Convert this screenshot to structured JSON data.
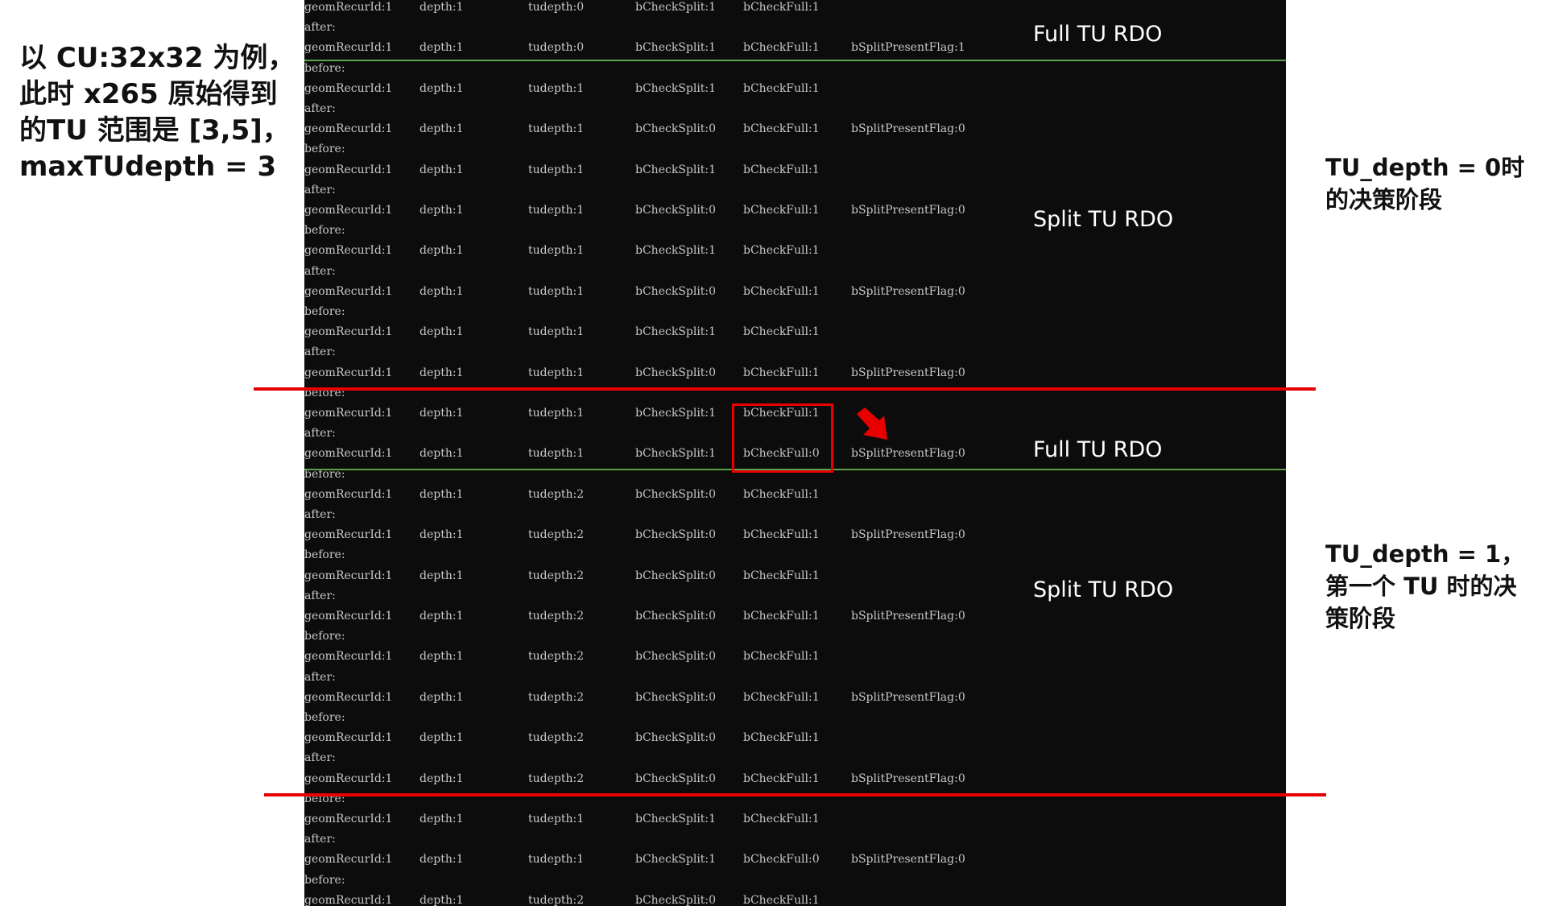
{
  "console": {
    "lines": [
      {
        "label": "geomRecurId:1",
        "depth": "depth:1",
        "tudepth": "tudepth:0",
        "split": "bCheckSplit:1",
        "full": "bCheckFull:1",
        "flag": ""
      },
      {
        "label": "after:",
        "depth": "",
        "tudepth": "",
        "split": "",
        "full": "",
        "flag": ""
      },
      {
        "label": "geomRecurId:1",
        "depth": "depth:1",
        "tudepth": "tudepth:0",
        "split": "bCheckSplit:1",
        "full": "bCheckFull:1",
        "flag": "bSplitPresentFlag:1"
      },
      {
        "label": "before:",
        "depth": "",
        "tudepth": "",
        "split": "",
        "full": "",
        "flag": ""
      },
      {
        "label": "geomRecurId:1",
        "depth": "depth:1",
        "tudepth": "tudepth:1",
        "split": "bCheckSplit:1",
        "full": "bCheckFull:1",
        "flag": ""
      },
      {
        "label": "after:",
        "depth": "",
        "tudepth": "",
        "split": "",
        "full": "",
        "flag": ""
      },
      {
        "label": "geomRecurId:1",
        "depth": "depth:1",
        "tudepth": "tudepth:1",
        "split": "bCheckSplit:0",
        "full": "bCheckFull:1",
        "flag": "bSplitPresentFlag:0"
      },
      {
        "label": "before:",
        "depth": "",
        "tudepth": "",
        "split": "",
        "full": "",
        "flag": ""
      },
      {
        "label": "geomRecurId:1",
        "depth": "depth:1",
        "tudepth": "tudepth:1",
        "split": "bCheckSplit:1",
        "full": "bCheckFull:1",
        "flag": ""
      },
      {
        "label": "after:",
        "depth": "",
        "tudepth": "",
        "split": "",
        "full": "",
        "flag": ""
      },
      {
        "label": "geomRecurId:1",
        "depth": "depth:1",
        "tudepth": "tudepth:1",
        "split": "bCheckSplit:0",
        "full": "bCheckFull:1",
        "flag": "bSplitPresentFlag:0"
      },
      {
        "label": "before:",
        "depth": "",
        "tudepth": "",
        "split": "",
        "full": "",
        "flag": ""
      },
      {
        "label": "geomRecurId:1",
        "depth": "depth:1",
        "tudepth": "tudepth:1",
        "split": "bCheckSplit:1",
        "full": "bCheckFull:1",
        "flag": ""
      },
      {
        "label": "after:",
        "depth": "",
        "tudepth": "",
        "split": "",
        "full": "",
        "flag": ""
      },
      {
        "label": "geomRecurId:1",
        "depth": "depth:1",
        "tudepth": "tudepth:1",
        "split": "bCheckSplit:0",
        "full": "bCheckFull:1",
        "flag": "bSplitPresentFlag:0"
      },
      {
        "label": "before:",
        "depth": "",
        "tudepth": "",
        "split": "",
        "full": "",
        "flag": ""
      },
      {
        "label": "geomRecurId:1",
        "depth": "depth:1",
        "tudepth": "tudepth:1",
        "split": "bCheckSplit:1",
        "full": "bCheckFull:1",
        "flag": ""
      },
      {
        "label": "after:",
        "depth": "",
        "tudepth": "",
        "split": "",
        "full": "",
        "flag": ""
      },
      {
        "label": "geomRecurId:1",
        "depth": "depth:1",
        "tudepth": "tudepth:1",
        "split": "bCheckSplit:0",
        "full": "bCheckFull:1",
        "flag": "bSplitPresentFlag:0"
      },
      {
        "label": "before:",
        "depth": "",
        "tudepth": "",
        "split": "",
        "full": "",
        "flag": ""
      },
      {
        "label": "geomRecurId:1",
        "depth": "depth:1",
        "tudepth": "tudepth:1",
        "split": "bCheckSplit:1",
        "full": "bCheckFull:1",
        "flag": ""
      },
      {
        "label": "after:",
        "depth": "",
        "tudepth": "",
        "split": "",
        "full": "",
        "flag": ""
      },
      {
        "label": "geomRecurId:1",
        "depth": "depth:1",
        "tudepth": "tudepth:1",
        "split": "bCheckSplit:1",
        "full": "bCheckFull:0",
        "flag": "bSplitPresentFlag:0"
      },
      {
        "label": "before:",
        "depth": "",
        "tudepth": "",
        "split": "",
        "full": "",
        "flag": ""
      },
      {
        "label": "geomRecurId:1",
        "depth": "depth:1",
        "tudepth": "tudepth:2",
        "split": "bCheckSplit:0",
        "full": "bCheckFull:1",
        "flag": ""
      },
      {
        "label": "after:",
        "depth": "",
        "tudepth": "",
        "split": "",
        "full": "",
        "flag": ""
      },
      {
        "label": "geomRecurId:1",
        "depth": "depth:1",
        "tudepth": "tudepth:2",
        "split": "bCheckSplit:0",
        "full": "bCheckFull:1",
        "flag": "bSplitPresentFlag:0"
      },
      {
        "label": "before:",
        "depth": "",
        "tudepth": "",
        "split": "",
        "full": "",
        "flag": ""
      },
      {
        "label": "geomRecurId:1",
        "depth": "depth:1",
        "tudepth": "tudepth:2",
        "split": "bCheckSplit:0",
        "full": "bCheckFull:1",
        "flag": ""
      },
      {
        "label": "after:",
        "depth": "",
        "tudepth": "",
        "split": "",
        "full": "",
        "flag": ""
      },
      {
        "label": "geomRecurId:1",
        "depth": "depth:1",
        "tudepth": "tudepth:2",
        "split": "bCheckSplit:0",
        "full": "bCheckFull:1",
        "flag": "bSplitPresentFlag:0"
      },
      {
        "label": "before:",
        "depth": "",
        "tudepth": "",
        "split": "",
        "full": "",
        "flag": ""
      },
      {
        "label": "geomRecurId:1",
        "depth": "depth:1",
        "tudepth": "tudepth:2",
        "split": "bCheckSplit:0",
        "full": "bCheckFull:1",
        "flag": ""
      },
      {
        "label": "after:",
        "depth": "",
        "tudepth": "",
        "split": "",
        "full": "",
        "flag": ""
      },
      {
        "label": "geomRecurId:1",
        "depth": "depth:1",
        "tudepth": "tudepth:2",
        "split": "bCheckSplit:0",
        "full": "bCheckFull:1",
        "flag": "bSplitPresentFlag:0"
      },
      {
        "label": "before:",
        "depth": "",
        "tudepth": "",
        "split": "",
        "full": "",
        "flag": ""
      },
      {
        "label": "geomRecurId:1",
        "depth": "depth:1",
        "tudepth": "tudepth:2",
        "split": "bCheckSplit:0",
        "full": "bCheckFull:1",
        "flag": ""
      },
      {
        "label": "after:",
        "depth": "",
        "tudepth": "",
        "split": "",
        "full": "",
        "flag": ""
      },
      {
        "label": "geomRecurId:1",
        "depth": "depth:1",
        "tudepth": "tudepth:2",
        "split": "bCheckSplit:0",
        "full": "bCheckFull:1",
        "flag": "bSplitPresentFlag:0"
      },
      {
        "label": "before:",
        "depth": "",
        "tudepth": "",
        "split": "",
        "full": "",
        "flag": ""
      },
      {
        "label": "geomRecurId:1",
        "depth": "depth:1",
        "tudepth": "tudepth:1",
        "split": "bCheckSplit:1",
        "full": "bCheckFull:1",
        "flag": ""
      },
      {
        "label": "after:",
        "depth": "",
        "tudepth": "",
        "split": "",
        "full": "",
        "flag": ""
      },
      {
        "label": "geomRecurId:1",
        "depth": "depth:1",
        "tudepth": "tudepth:1",
        "split": "bCheckSplit:1",
        "full": "bCheckFull:0",
        "flag": "bSplitPresentFlag:0"
      },
      {
        "label": "before:",
        "depth": "",
        "tudepth": "",
        "split": "",
        "full": "",
        "flag": ""
      },
      {
        "label": "geomRecurId:1",
        "depth": "depth:1",
        "tudepth": "tudepth:2",
        "split": "bCheckSplit:0",
        "full": "bCheckFull:1",
        "flag": ""
      }
    ]
  },
  "overlays": {
    "full_tu_rdo_1": "Full TU RDO",
    "split_tu_rdo_1": "Split TU RDO",
    "full_tu_rdo_2": "Full TU RDO",
    "split_tu_rdo_2": "Split TU RDO"
  },
  "notes": {
    "left": "以 CU:32x32 为例，\n此时 x265 原始得到\n的TU 范围是 [3,5]，\nmaxTUdepth = 3",
    "right_1": "TU_depth = 0时\n的决策阶段",
    "right_2": "TU_depth = 1，\n第一个 TU 时的决\n策阶段"
  },
  "colors": {
    "console_bg": "#0c0c0c",
    "console_text": "#c8c8c8",
    "separator_green": "#5aa34a",
    "marker_red": "#e80000"
  },
  "icons": {
    "arrow": "red-arrow-icon"
  }
}
